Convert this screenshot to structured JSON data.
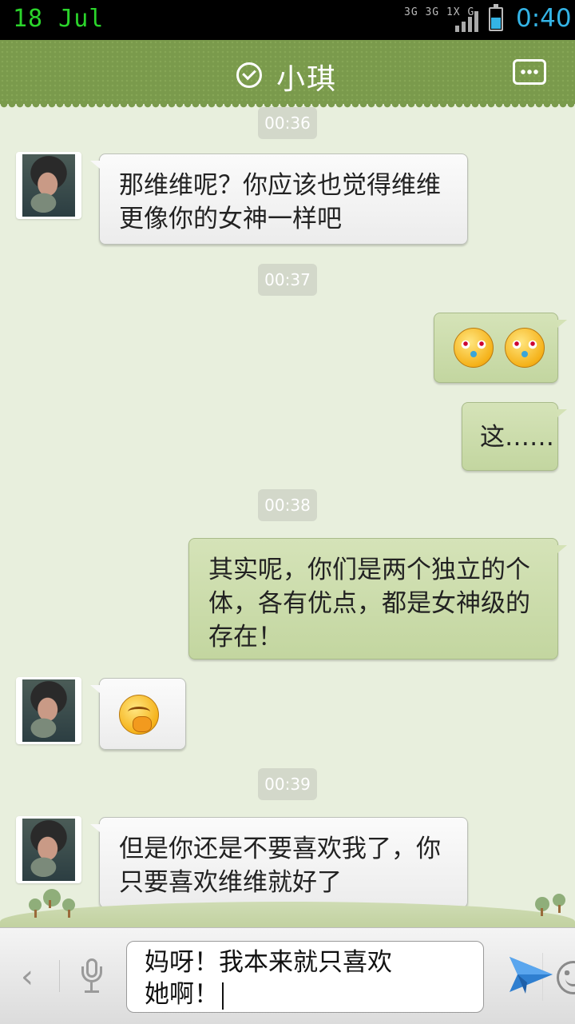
{
  "status_bar": {
    "date": "18 Jul",
    "network": "3G 3G 1X G",
    "time": "0:40",
    "battery_level": 0.55
  },
  "header": {
    "title": "小琪",
    "verified_icon": "check-circle-icon",
    "menu_icon": "more-icon"
  },
  "timestamps": [
    "00:36",
    "00:37",
    "00:38",
    "00:39"
  ],
  "messages": [
    {
      "from": "contact",
      "type": "text",
      "text": "那维维呢？你应该也觉得维维更像你的女神一样吧"
    },
    {
      "from": "me",
      "type": "emoji",
      "emoji": [
        "angry-face-icon",
        "angry-face-icon"
      ]
    },
    {
      "from": "me",
      "type": "text",
      "text": "这……"
    },
    {
      "from": "me",
      "type": "text",
      "text": "其实呢，你们是两个独立的个体，各有优点，都是女神级的存在！"
    },
    {
      "from": "contact",
      "type": "emoji",
      "emoji": [
        "shy-face-icon"
      ]
    },
    {
      "from": "contact",
      "type": "text",
      "text": "但是你还是不要喜欢我了，你只要喜欢维维就好了"
    }
  ],
  "input": {
    "value": "妈呀！我本来就只喜欢她啊！",
    "back_icon": "chevron-left-icon",
    "voice_icon": "microphone-icon",
    "emoji_icon": "smiley-icon",
    "send_icon": "send-icon"
  },
  "colors": {
    "header": "#7a9a4c",
    "background": "#e8efdd",
    "outgoing_bubble": "#c9dba8",
    "incoming_bubble": "#f4f4f4",
    "accent": "#34b4e6"
  }
}
